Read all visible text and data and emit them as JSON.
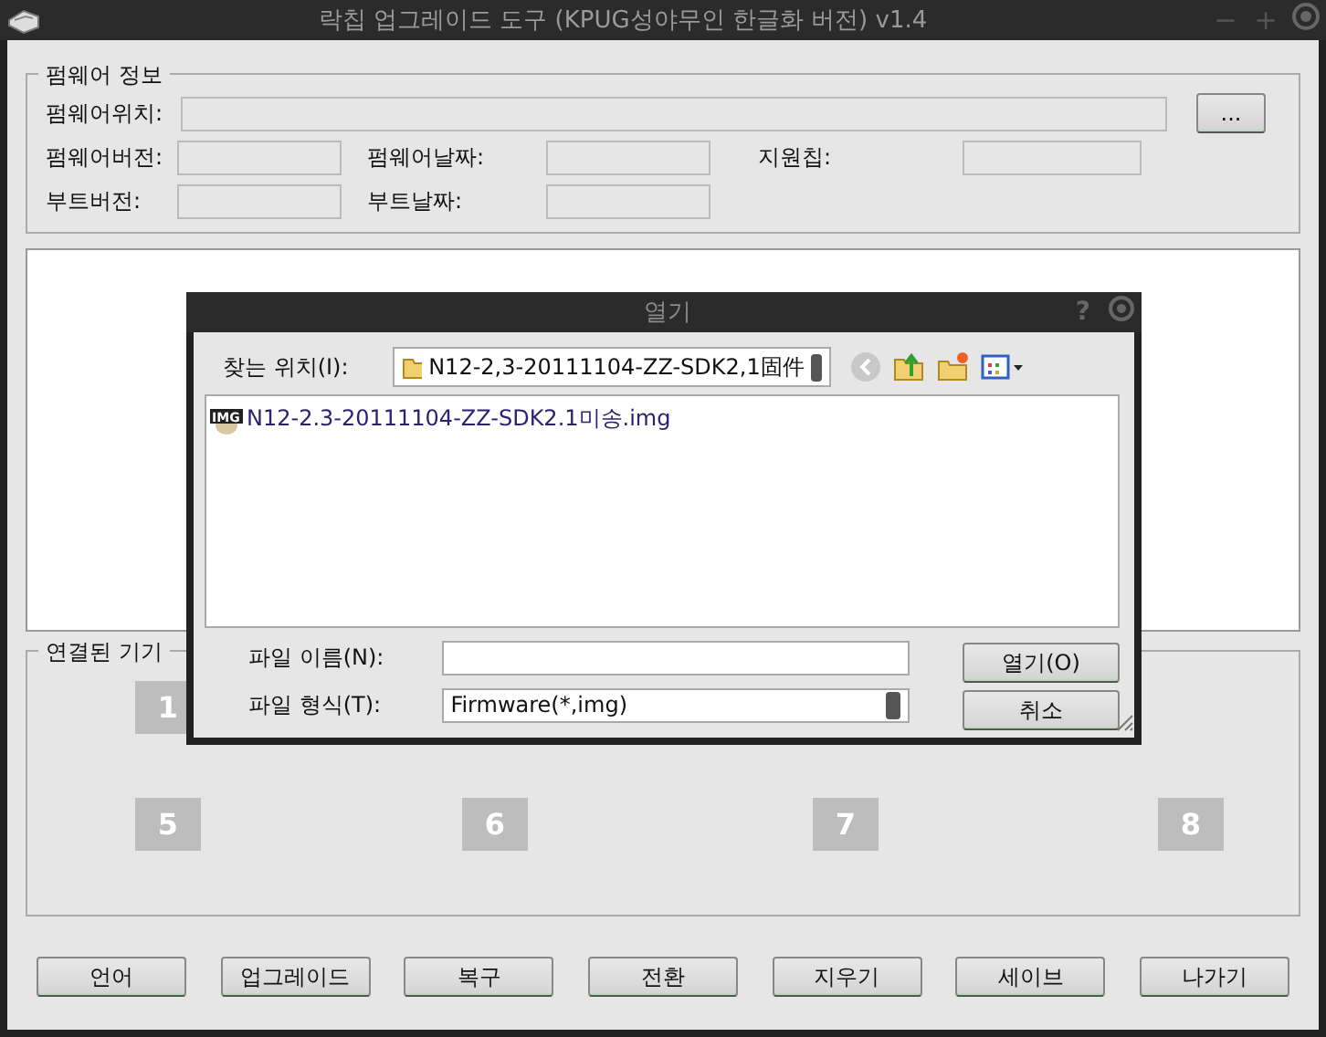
{
  "window": {
    "title": "락칩 업그레이드 도구 (KPUG성야무인 한글화 버전) v1.4",
    "controls": [
      "−",
      "+"
    ]
  },
  "firmware_info": {
    "title": "펌웨어 정보",
    "browse_button": "...",
    "rows": [
      [
        {
          "label": "펌웨어위치:",
          "kind": "wide"
        }
      ],
      [
        {
          "label": "펌웨어버전:",
          "kind": "short"
        },
        {
          "label": "펌웨어날짜:",
          "kind": "short"
        },
        {
          "label": "지원칩:",
          "kind": "short"
        }
      ],
      [
        {
          "label": "부트버전:",
          "kind": "short"
        },
        {
          "label": "부트날짜:",
          "kind": "short"
        }
      ]
    ]
  },
  "devices": {
    "title": "연결된 기기",
    "rows": [
      [
        "1"
      ],
      [
        "5",
        "6",
        "7",
        "8"
      ]
    ]
  },
  "buttons": [
    "언어",
    "업그레이드",
    "복구",
    "전환",
    "지우기",
    "세이브",
    "나가기"
  ],
  "dialog": {
    "title": "열기",
    "help": "?",
    "look_in_label": "찾는 위치(I):",
    "look_in_value": "N12-2,3-20111104-ZZ-SDK2,1固件",
    "files": [
      {
        "name": "N12-2.3-20111104-ZZ-SDK2.1미송.img",
        "icon_text": "IMG",
        "selected": false
      }
    ],
    "file_name_label": "파일 이름(N):",
    "file_type_label": "파일 형식(T):",
    "file_type_value": "Firmware(*,img)",
    "open_button": "열기(O)",
    "cancel_button": "취소"
  }
}
